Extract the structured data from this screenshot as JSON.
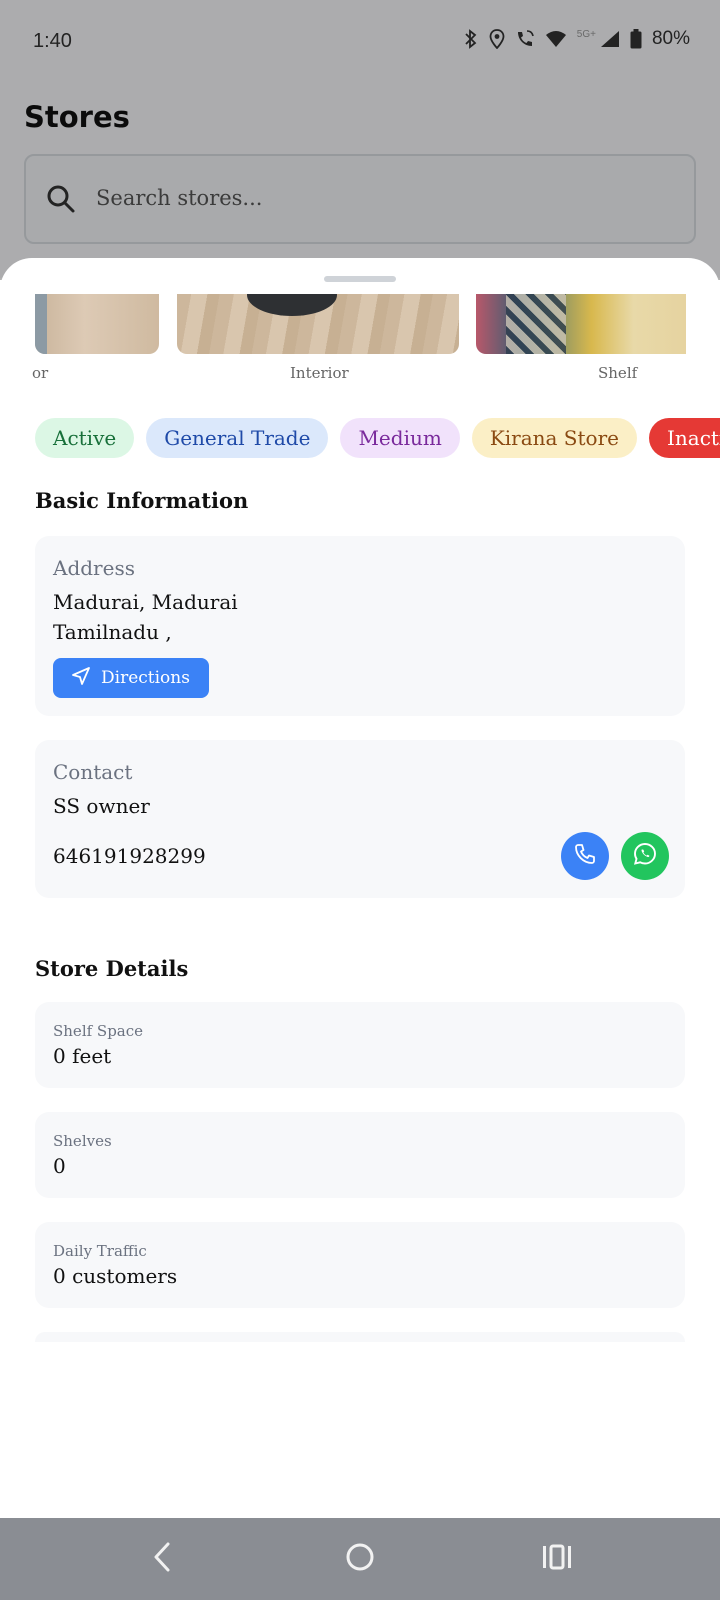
{
  "status_bar": {
    "time": "1:40",
    "network_label": "5G+",
    "battery": "80%",
    "icons": [
      "bluetooth-icon",
      "location-icon",
      "wifi-call-icon",
      "wifi-icon",
      "signal-icon",
      "battery-icon"
    ]
  },
  "background_page": {
    "title": "Stores",
    "search_placeholder": "Search stores..."
  },
  "photos": {
    "labels": [
      "or",
      "Interior",
      "Shelf"
    ]
  },
  "chips": [
    {
      "label": "Active",
      "color": "#dcf7e5"
    },
    {
      "label": "General Trade",
      "color": "#dbe8fb"
    },
    {
      "label": "Medium",
      "color": "#f1e2fb"
    },
    {
      "label": "Kirana Store",
      "color": "#fbefc6"
    },
    {
      "label": "Inactiva",
      "color": "#e53935"
    }
  ],
  "basic_info": {
    "section_title": "Basic Information",
    "address_label": "Address",
    "address_line1": "Madurai, Madurai",
    "address_line2": "Tamilnadu ,",
    "directions_label": "Directions",
    "contact_label": "Contact",
    "contact_name": "SS owner",
    "contact_phone": "646191928299"
  },
  "store_details": {
    "section_title": "Store Details",
    "items": [
      {
        "label": "Shelf Space",
        "value": "0 feet"
      },
      {
        "label": "Shelves",
        "value": "0"
      },
      {
        "label": "Daily Traffic",
        "value": "0 customers"
      }
    ]
  },
  "colors": {
    "primary_blue": "#3b82f6",
    "whatsapp_green": "#22c55e",
    "inactive_red": "#e53935"
  }
}
